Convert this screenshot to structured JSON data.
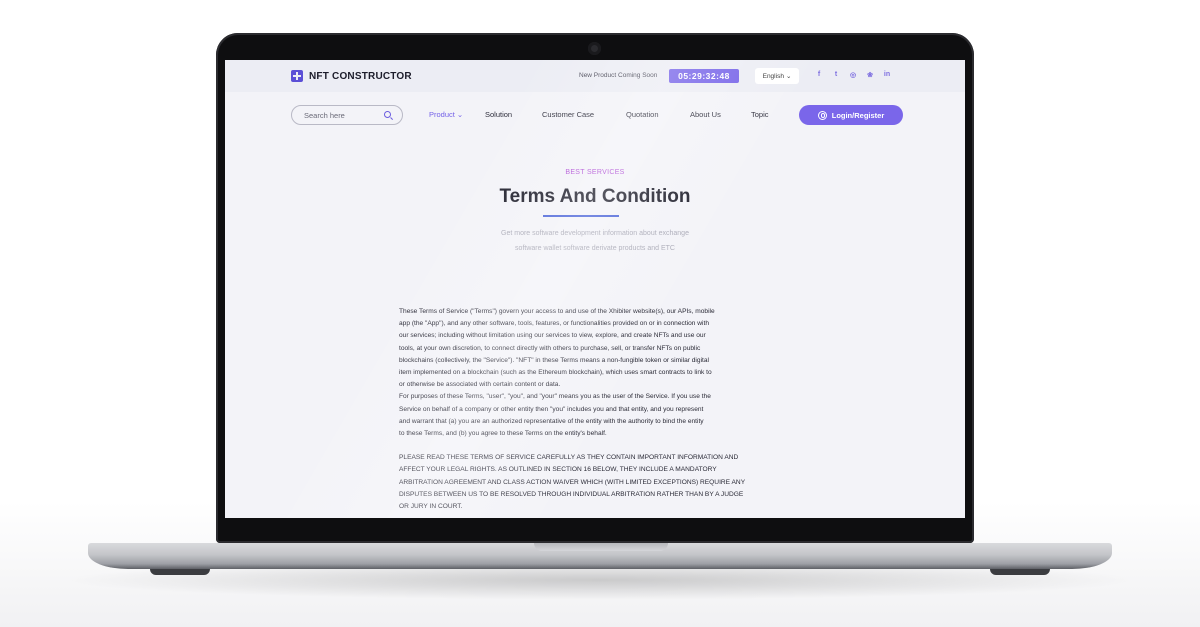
{
  "header": {
    "logo_text": "NFT CONSTRUCTOR",
    "coming_soon": "New Product Coming Soon",
    "timer": "05:29:32:48",
    "language": "English",
    "language_chevron": "⌄"
  },
  "socials": [
    {
      "name": "facebook-icon",
      "glyph": "f"
    },
    {
      "name": "twitter-icon",
      "glyph": "t"
    },
    {
      "name": "instagram-icon",
      "glyph": "◎"
    },
    {
      "name": "dribbble-icon",
      "glyph": "❀"
    },
    {
      "name": "linkedin-icon",
      "glyph": "in"
    }
  ],
  "nav": {
    "search_placeholder": "Search here",
    "items": [
      "Product ⌄",
      "Solution",
      "Customer Case",
      "Quotation",
      "About Us",
      "Topic"
    ],
    "login": "Login/Register"
  },
  "hero": {
    "eyebrow": "BEST SERVICES",
    "title": "Terms And Condition",
    "subtitle_line1": "Get more software development information about exchange",
    "subtitle_line2": "software wallet software derivate products and ETC"
  },
  "terms": {
    "lines_1": [
      "These Terms of Service (\"Terms\") govern your access to and use of the Xhibiter website(s), our APIs, mobile",
      "app (the \"App\"), and any other software, tools, features, or functionalities provided on or in connection with",
      "our services; including without limitation using our services to view, explore, and create NFTs and use our",
      "tools, at your own discretion, to connect directly with others to purchase, sell, or transfer NFTs on public",
      "blockchains (collectively, the \"Service\"). \"NFT\" in these Terms means a non-fungible token or similar digital",
      "item implemented on a blockchain (such as the Ethereum blockchain), which uses smart contracts to link to",
      "or otherwise be associated with certain content or data.",
      "For purposes of these Terms, \"user\", \"you\", and \"your\" means you as the user of the Service. If you use the",
      "Service on behalf of a company or other entity then \"you\" includes you and that entity, and you represent",
      "and warrant that (a) you are an authorized representative of the entity with the authority to bind the entity",
      "to these Terms, and (b) you agree to these Terms on the entity's behalf."
    ],
    "lines_2": [
      "PLEASE READ THESE TERMS OF SERVICE CAREFULLY AS THEY CONTAIN IMPORTANT INFORMATION AND",
      "AFFECT YOUR LEGAL RIGHTS. AS OUTLINED IN SECTION 16 BELOW, THEY INCLUDE A MANDATORY",
      "ARBITRATION AGREEMENT AND CLASS ACTION WAIVER WHICH (WITH LIMITED EXCEPTIONS) REQUIRE ANY",
      "DISPUTES BETWEEN US TO BE RESOLVED THROUGH INDIVIDUAL ARBITRATION RATHER THAN BY A JUDGE",
      "OR JURY IN COURT."
    ]
  },
  "colors": {
    "accent": "#7461e8",
    "eyebrow": "#b04fd6",
    "title_underline": "#4a63d8"
  }
}
